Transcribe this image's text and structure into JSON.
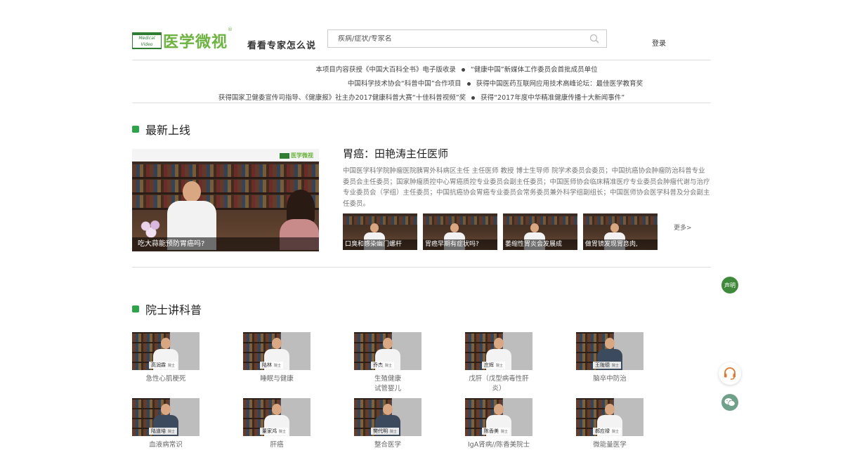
{
  "header": {
    "logo_badge_text": "Medical Video",
    "logo_name": "医学微视",
    "logo_reg": "®",
    "slogan": "看看专家怎么说",
    "search_placeholder": "疾病/症状/专家名",
    "login_label": "登录",
    "search_icon": "search-icon"
  },
  "notices": {
    "line1": [
      "本项目内容获授《中国大百科全书》电子版收录",
      "“健康中国”新媒体工作委员会首批成员单位"
    ],
    "line2": [
      "中国科学技术协会“科普中国”合作项目",
      "获得中国医药互联网应用技术高峰论坛：最佳医学教育奖"
    ],
    "line3": [
      "获得国家卫健委宣传司指导、《健康报》社主办2017健康科普大赛“十佳科普视频”奖",
      "获得“2017年度中华精准健康传播十大新闻事件”"
    ]
  },
  "latest": {
    "section_title": "最新上线",
    "video_logo": "医学微视",
    "video_caption": "吃大蒜能预防胃癌吗?",
    "title": "胃癌：田艳涛主任医师",
    "description": "中国医学科学院肿瘤医院胰胃外科病区主任 主任医师 教授 博士生导师 院学术委员会委员；中国抗癌协会肿瘤防治科普专业委员会主任委员；国家肿瘤质控中心胃癌质控专业委员会副主任委员；中国医师协会临床精准医疗专业委员会肿瘤代谢与治疗专业委员会（学组）主任委员；中国抗癌协会胃癌专业委员会常务委员兼外科学组副组长；中国医师协会医学科普及分会副主任委员。",
    "thumbs": [
      {
        "caption": "口臭和感染幽门螺杆"
      },
      {
        "caption": "胃癌早期有症状吗?"
      },
      {
        "caption": "萎缩性胃炎会发展成"
      },
      {
        "caption": "做胃镜发现胃息肉,"
      }
    ],
    "more_label": "更多>"
  },
  "academicians": {
    "section_title": "院士讲科普",
    "cards": [
      {
        "name": "高润霖",
        "tag": "院士",
        "label": "急性心肌梗死",
        "dark": false
      },
      {
        "name": "陆林",
        "tag": "院士",
        "label": "睡眠与健康",
        "dark": false
      },
      {
        "name": "乔杰",
        "tag": "院士",
        "label": "生殖健康\n试管婴儿",
        "dark": false
      },
      {
        "name": "庄辉",
        "tag": "院士",
        "label": "戊肝（戊型病毒性肝炎）",
        "dark": false
      },
      {
        "name": "王陇德",
        "tag": "院士",
        "label": "脑卒中防治",
        "dark": true
      },
      {
        "name": "陆道培",
        "tag": "院士",
        "label": "血液病常识",
        "dark": true
      },
      {
        "name": "董家鸿",
        "tag": "院士",
        "label": "肝癌",
        "dark": false
      },
      {
        "name": "樊代明",
        "tag": "院士",
        "label": "整合医学",
        "dark": true
      },
      {
        "name": "陈香美",
        "tag": "院士",
        "label": "IgA肾病//陈香美院士",
        "dark": false
      },
      {
        "name": "郝应禄",
        "tag": "院士",
        "label": "微能量医学",
        "dark": false
      }
    ]
  },
  "floating": {
    "statement_label": "声明",
    "service_icon": "headset-icon",
    "wechat_icon": "wechat-icon"
  },
  "colors": {
    "brand_green": "#6cb33f",
    "section_marker": "#2fa34a",
    "statement_bg": "#3f8a3a"
  }
}
